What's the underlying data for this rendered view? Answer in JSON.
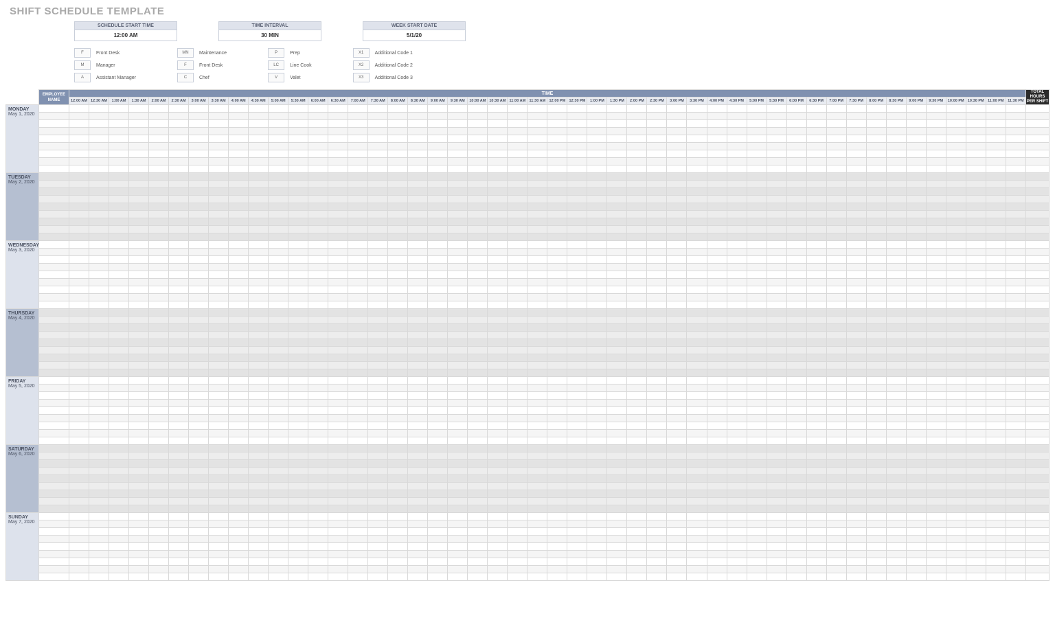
{
  "title": "SHIFT SCHEDULE TEMPLATE",
  "params": {
    "start_time": {
      "label": "SCHEDULE START TIME",
      "value": "12:00 AM"
    },
    "interval": {
      "label": "TIME INTERVAL",
      "value": "30 MIN"
    },
    "week_start": {
      "label": "WEEK START DATE",
      "value": "5/1/20"
    }
  },
  "legend": [
    [
      {
        "code": "F",
        "label": "Front Desk"
      },
      {
        "code": "M",
        "label": "Manager"
      },
      {
        "code": "A",
        "label": "Assistant Manager"
      }
    ],
    [
      {
        "code": "MN",
        "label": "Maintenance"
      },
      {
        "code": "F",
        "label": "Front Desk"
      },
      {
        "code": "C",
        "label": "Chef"
      }
    ],
    [
      {
        "code": "P",
        "label": "Prep"
      },
      {
        "code": "LC",
        "label": "Line Cook"
      },
      {
        "code": "V",
        "label": "Valet"
      }
    ],
    [
      {
        "code": "X1",
        "label": "Additional Code 1"
      },
      {
        "code": "X2",
        "label": "Additional Code 2"
      },
      {
        "code": "X3",
        "label": "Additional Code 3"
      }
    ]
  ],
  "headers": {
    "employee_name": "EMPLOYEE NAME",
    "time": "TIME",
    "total": "TOTAL HOURS PER SHIFT"
  },
  "time_slots": [
    "12:00 AM",
    "12:30 AM",
    "1:00 AM",
    "1:30 AM",
    "2:00 AM",
    "2:30 AM",
    "3:00 AM",
    "3:30 AM",
    "4:00 AM",
    "4:30 AM",
    "5:00 AM",
    "5:30 AM",
    "6:00 AM",
    "6:30 AM",
    "7:00 AM",
    "7:30 AM",
    "8:00 AM",
    "8:30 AM",
    "9:00 AM",
    "9:30 AM",
    "10:00 AM",
    "10:30 AM",
    "11:00 AM",
    "11:30 AM",
    "12:00 PM",
    "12:30 PM",
    "1:00 PM",
    "1:30 PM",
    "2:00 PM",
    "2:30 PM",
    "3:00 PM",
    "3:30 PM",
    "4:00 PM",
    "4:30 PM",
    "5:00 PM",
    "5:30 PM",
    "6:00 PM",
    "6:30 PM",
    "7:00 PM",
    "7:30 PM",
    "8:00 PM",
    "8:30 PM",
    "9:00 PM",
    "9:30 PM",
    "10:00 PM",
    "10:30 PM",
    "11:00 PM",
    "11:30 PM"
  ],
  "days": [
    {
      "dow": "MONDAY",
      "date": "May 1, 2020",
      "style": "light"
    },
    {
      "dow": "TUESDAY",
      "date": "May 2, 2020",
      "style": "dark"
    },
    {
      "dow": "WEDNESDAY",
      "date": "May 3, 2020",
      "style": "light"
    },
    {
      "dow": "THURSDAY",
      "date": "May 4, 2020",
      "style": "dark"
    },
    {
      "dow": "FRIDAY",
      "date": "May 5, 2020",
      "style": "light"
    },
    {
      "dow": "SATURDAY",
      "date": "May 6, 2020",
      "style": "dark"
    },
    {
      "dow": "SUNDAY",
      "date": "May 7, 2020",
      "style": "light"
    }
  ],
  "rows_per_day": 9
}
